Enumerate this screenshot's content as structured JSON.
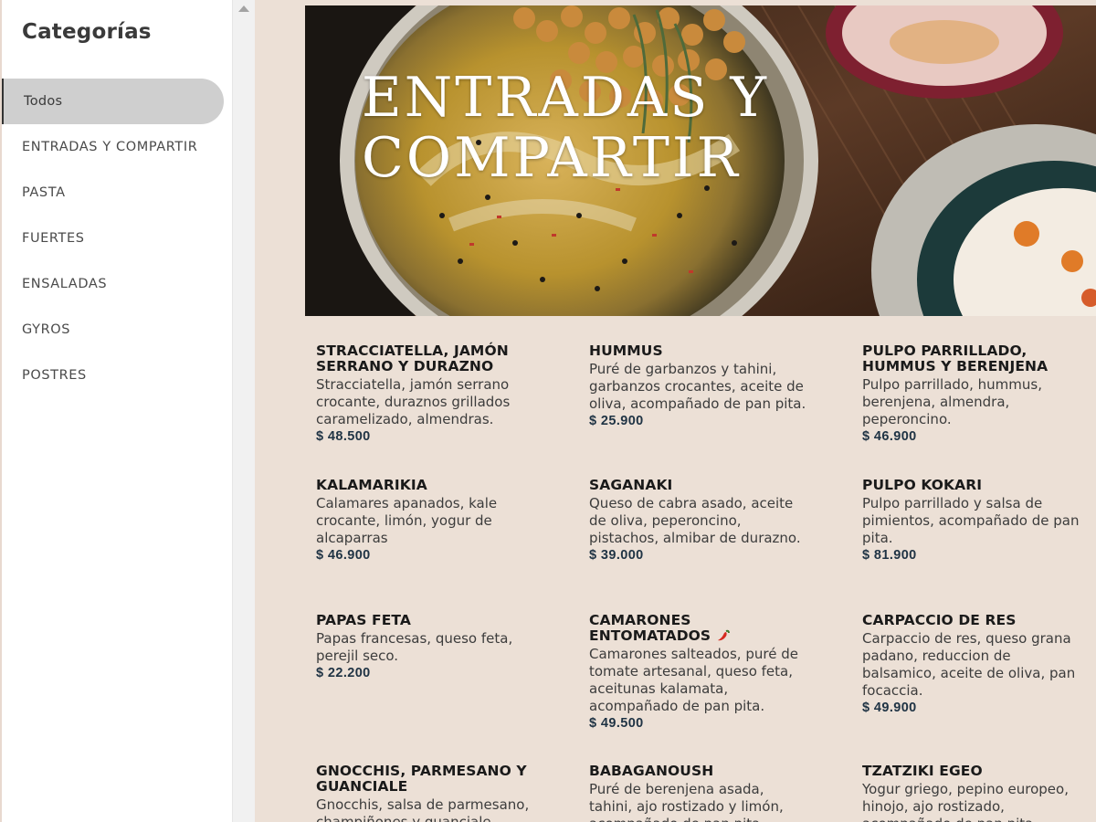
{
  "sidebar": {
    "title": "Categorías",
    "categories": [
      {
        "label": "Todos"
      },
      {
        "label": "ENTRADAS Y COMPARTIR"
      },
      {
        "label": "PASTA"
      },
      {
        "label": "FUERTES"
      },
      {
        "label": "ENSALADAS"
      },
      {
        "label": "GYROS"
      },
      {
        "label": "POSTRES"
      }
    ],
    "active_index": 0
  },
  "banner": {
    "line1": "ENTRADAS Y",
    "line2": "COMPARTIR"
  },
  "colors": {
    "background": "#ece0d6",
    "price": "#1f3344",
    "active_category": "#cfcfcf"
  },
  "items": [
    {
      "name": "STRACCIATELLA, JAMÓN SERRANO Y DURAZNO",
      "desc": "Stracciatella, jamón serrano crocante, duraznos grillados caramelizado, almendras.",
      "price": "$ 48.500"
    },
    {
      "name": "HUMMUS",
      "desc": "Puré de garbanzos y tahini, garbanzos crocantes, aceite de oliva, acompañado de pan pita.",
      "price": "$ 25.900"
    },
    {
      "name": "PULPO PARRILLADO, HUMMUS Y BERENJENA",
      "desc": "Pulpo parrillado, hummus, berenjena, almendra, peperoncino.",
      "price": "$ 46.900"
    },
    {
      "name": "KALAMARIKIA",
      "desc": "Calamares apanados, kale crocante, limón, yogur de alcaparras",
      "price": "$ 46.900"
    },
    {
      "name": "SAGANAKI",
      "desc": "Queso de cabra asado, aceite de oliva, peperoncino, pistachos, almibar de durazno.",
      "price": "$ 39.000"
    },
    {
      "name": "PULPO KOKARI",
      "desc": "Pulpo parrillado y salsa de pimientos, acompañado de pan pita.",
      "price": "$ 81.900"
    },
    {
      "name": "PAPAS FETA",
      "desc": "Papas francesas, queso feta, perejil seco.",
      "price": "$ 22.200"
    },
    {
      "name": "CAMARONES ENTOMATADOS",
      "icon": "chili-pepper-icon",
      "desc": "Camarones salteados, puré de tomate artesanal, queso feta, aceitunas kalamata, acompañado de pan pita.",
      "price": "$ 49.500"
    },
    {
      "name": "CARPACCIO DE RES",
      "desc": "Carpaccio de res, queso grana padano, reduccion de balsamico, aceite de oliva, pan focaccia.",
      "price": "$ 49.900"
    },
    {
      "name": "GNOCCHIS, PARMESANO Y GUANCIALE",
      "desc": "Gnocchis, salsa de parmesano, champiñones y guanciale.",
      "price": ""
    },
    {
      "name": "BABAGANOUSH",
      "desc": "Puré de berenjena asada, tahini, ajo rostizado y limón, acompañado de pan pita.",
      "price": ""
    },
    {
      "name": "TZATZIKI EGEO",
      "desc": "Yogur griego, pepino europeo, hinojo, ajo rostizado, acompañado de pan pita.",
      "price": ""
    }
  ]
}
